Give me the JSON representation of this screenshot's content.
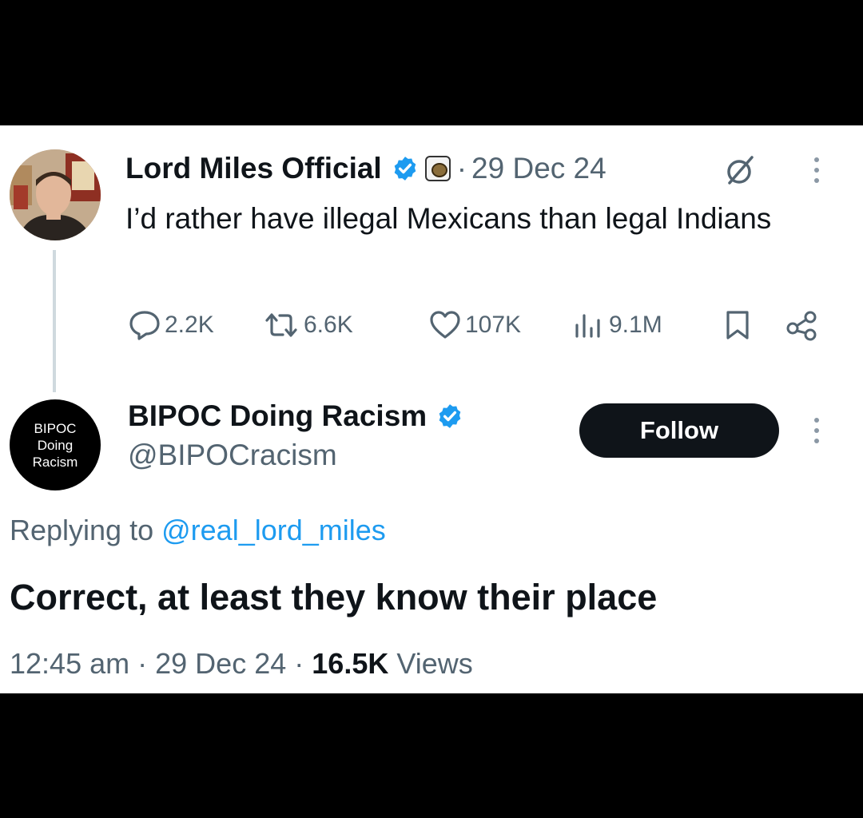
{
  "parent_tweet": {
    "display_name": "Lord Miles Official",
    "separator": "·",
    "date": "29 Dec 24",
    "text": "I’d rather have illegal Mexicans than legal Indians",
    "stats": {
      "replies": "2.2K",
      "reposts": "6.6K",
      "likes": "107K",
      "views": "9.1M"
    },
    "icons": [
      "verified-badge-icon",
      "affiliate-badge-icon",
      "grok-icon",
      "more-icon",
      "reply-icon",
      "repost-icon",
      "like-icon",
      "views-icon",
      "bookmark-icon",
      "share-icon"
    ]
  },
  "reply_tweet": {
    "avatar_text": [
      "BIPOC",
      "Doing",
      "Racism"
    ],
    "display_name": "BIPOC Doing Racism",
    "handle": "@BIPOCracism",
    "follow_label": "Follow",
    "replying_prefix": "Replying to",
    "replying_mention": "@real_lord_miles",
    "text": "Correct, at least they know their place",
    "time": "12:45 am",
    "separator": "·",
    "date": "29 Dec 24",
    "views_count": "16.5K",
    "views_label": "Views"
  },
  "colors": {
    "accent": "#1d9bf0",
    "text_primary": "#0f1419",
    "text_secondary": "#536471",
    "border": "#cfd9de",
    "frame": "#000000"
  }
}
